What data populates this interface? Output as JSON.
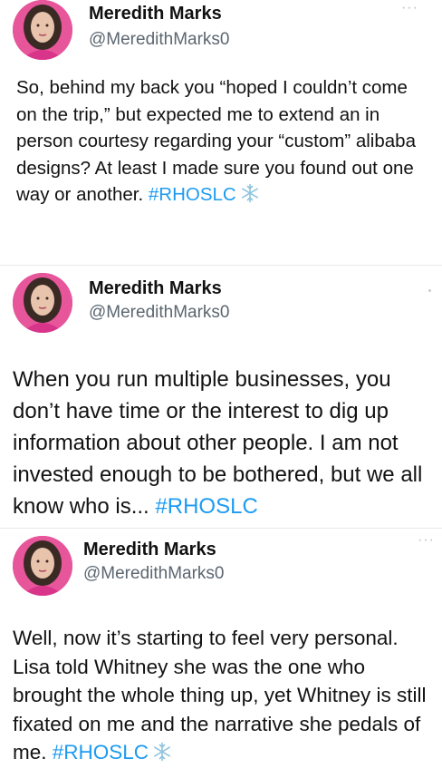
{
  "tweets": [
    {
      "author_name": "Meredith Marks",
      "author_handle": "@MeredithMarks0",
      "more_label": "···",
      "text": "So, behind my back you “hoped I couldn’t come on the trip,” but expected me to extend an in person courtesy regarding your “custom” alibaba designs? At least I made sure you found out one way or another. ",
      "hashtag": "#RHOSLC",
      "emoji_icon": "snowflake-icon"
    },
    {
      "author_name": "Meredith Marks",
      "author_handle": "@MeredithMarks0",
      "text": "When you run multiple businesses, you don’t have time or the interest to dig up information about other people. I am not invested enough to be bothered, but we all know who is... ",
      "hashtag": "#RHOSLC"
    },
    {
      "author_name": "Meredith Marks",
      "author_handle": "@MeredithMarks0",
      "more_label": "···",
      "text": "Well, now it’s starting to feel very personal. Lisa told Whitney she was the one who brought the whole thing up, yet Whitney is still fixated on me and the narrative she pedals of me. ",
      "hashtag": "#RHOSLC",
      "emoji_icon": "snowflake-icon"
    }
  ],
  "colors": {
    "hashtag": "#1d9bf0",
    "handle": "#5b6670",
    "avatar_bg": "#e7559b",
    "snowflake": "#8fc4de"
  }
}
